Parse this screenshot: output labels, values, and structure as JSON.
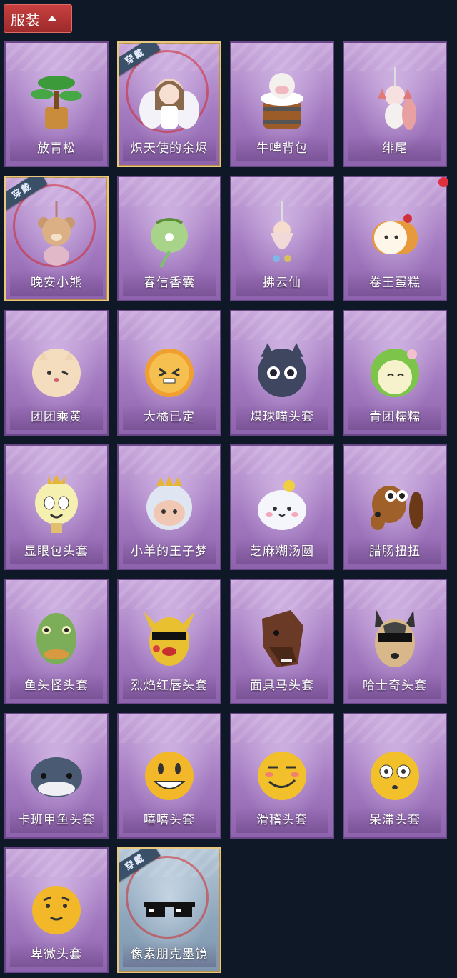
{
  "header": {
    "tab_label": "服装"
  },
  "worn_badge": "穿戴",
  "items": [
    {
      "label": "放青松",
      "icon": "bonsai-pine-icon",
      "worn": false
    },
    {
      "label": "炽天使的余烬",
      "icon": "angel-pendant-icon",
      "worn": true
    },
    {
      "label": "牛啤背包",
      "icon": "cow-beer-backpack-icon",
      "worn": false
    },
    {
      "label": "绯尾",
      "icon": "fox-tail-pendant-icon",
      "worn": false
    },
    {
      "label": "晚安小熊",
      "icon": "teddy-bear-pendant-icon",
      "worn": true
    },
    {
      "label": "春信香囊",
      "icon": "sachet-icon",
      "worn": false
    },
    {
      "label": "拂云仙",
      "icon": "fairy-pendant-icon",
      "worn": false
    },
    {
      "label": "卷王蛋糕",
      "icon": "roll-cake-icon",
      "worn": false
    },
    {
      "label": "团团乘黄",
      "icon": "round-creature-head-icon",
      "worn": false
    },
    {
      "label": "大橘已定",
      "icon": "orange-head-icon",
      "worn": false
    },
    {
      "label": "煤球喵头套",
      "icon": "black-cat-head-icon",
      "worn": false
    },
    {
      "label": "青团糯糯",
      "icon": "green-dumpling-head-icon",
      "worn": false
    },
    {
      "label": "显眼包头套",
      "icon": "lightbulb-head-icon",
      "worn": false
    },
    {
      "label": "小羊的王子梦",
      "icon": "sheep-crown-head-icon",
      "worn": false
    },
    {
      "label": "芝麻糊汤圆",
      "icon": "rice-ball-head-icon",
      "worn": false
    },
    {
      "label": "腊肠扭扭",
      "icon": "dachshund-head-icon",
      "worn": false
    },
    {
      "label": "鱼头怪头套",
      "icon": "fish-head-mask-icon",
      "worn": false
    },
    {
      "label": "烈焰红唇头套",
      "icon": "pikachu-sunglasses-head-icon",
      "worn": false
    },
    {
      "label": "面具马头套",
      "icon": "horse-head-mask-icon",
      "worn": false
    },
    {
      "label": "哈士奇头套",
      "icon": "husky-sunglasses-head-icon",
      "worn": false
    },
    {
      "label": "卡班甲鱼头套",
      "icon": "whale-head-icon",
      "worn": false
    },
    {
      "label": "嘻嘻头套",
      "icon": "grin-emoji-head-icon",
      "worn": false
    },
    {
      "label": "滑稽头套",
      "icon": "smirk-emoji-head-icon",
      "worn": false
    },
    {
      "label": "呆滞头套",
      "icon": "dazed-emoji-head-icon",
      "worn": false
    },
    {
      "label": "卑微头套",
      "icon": "humble-emoji-head-icon",
      "worn": false
    },
    {
      "label": "像素朋克墨镜",
      "icon": "pixel-sunglasses-icon",
      "worn": true
    }
  ],
  "colors": {
    "background": "#0f1826",
    "header_tab": "#b33637",
    "card_purple": "#a47bc1",
    "worn_border": "#e9c77f",
    "notification_dot": "#e03040"
  }
}
